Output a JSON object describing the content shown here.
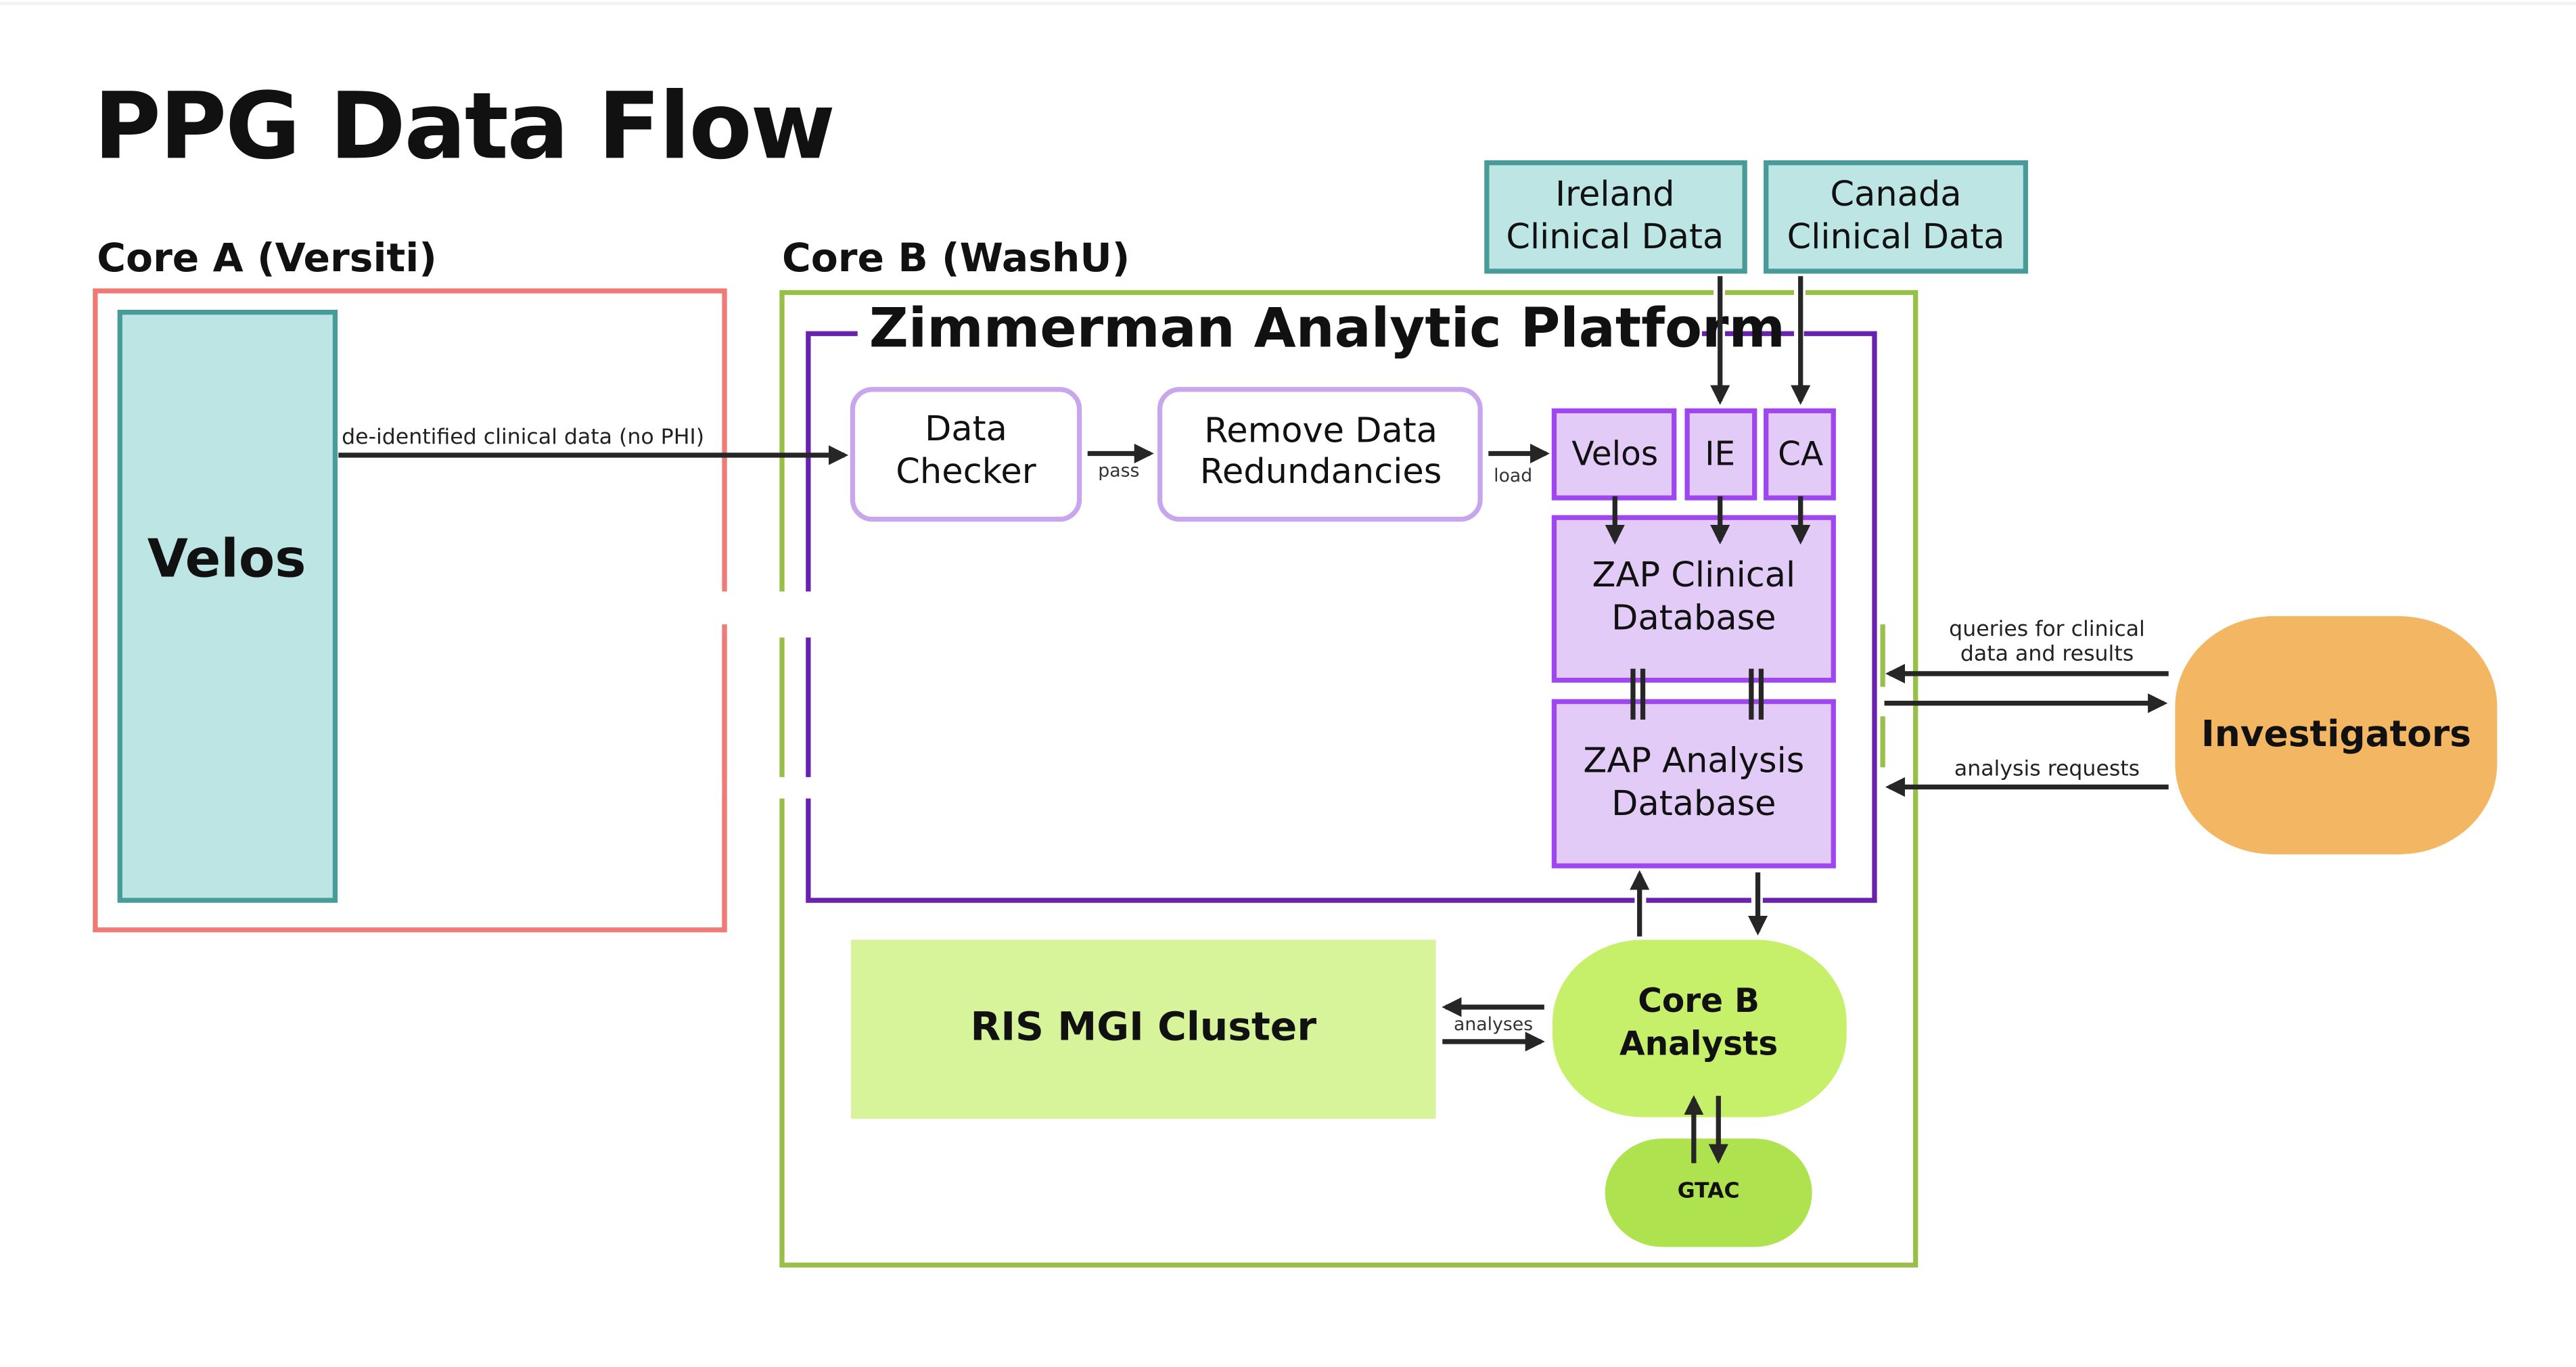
{
  "title": "PPG Data Flow",
  "colors": {
    "core_a_border": "#ef7a76",
    "core_b_border": "#98bf47",
    "zap_border": "#6b21b0",
    "teal_fill": "#bce5e4",
    "teal_border": "#479b98",
    "process_border": "#c8a6ee",
    "db_fill": "#e2ccf7",
    "db_border": "#a046f0",
    "investigators_fill": "#f3b764",
    "cluster_fill": "#d7f49a",
    "analysts_fill": "#c6f06a",
    "gtac_fill": "#aee24e",
    "arrow": "#262626"
  },
  "core_a": {
    "label": "Core A (Versiti)",
    "velos": "Velos"
  },
  "core_b": {
    "label": "Core B (WashU)",
    "platform": {
      "title": "Zimmerman Analytic Platform",
      "data_checker": [
        "Data",
        "Checker"
      ],
      "remove_redundancies": [
        "Remove Data",
        "Redundancies"
      ],
      "sources": [
        "Velos",
        "IE",
        "CA"
      ],
      "clinical_db": [
        "ZAP Clinical",
        "Database"
      ],
      "analysis_db": [
        "ZAP Analysis",
        "Database"
      ]
    },
    "ris_cluster": "RIS MGI Cluster",
    "analysts": [
      "Core B",
      "Analysts"
    ],
    "gtac": "GTAC"
  },
  "external": {
    "ireland": [
      "Ireland",
      "Clinical Data"
    ],
    "canada": [
      "Canada",
      "Clinical Data"
    ],
    "investigators": "Investigators"
  },
  "edges": {
    "deidentified": "de-identified clinical data (no PHI)",
    "pass": "pass",
    "load": "load",
    "queries": [
      "queries for clinical",
      "data and results"
    ],
    "analysis_requests": "analysis requests",
    "analyses": "analyses"
  }
}
